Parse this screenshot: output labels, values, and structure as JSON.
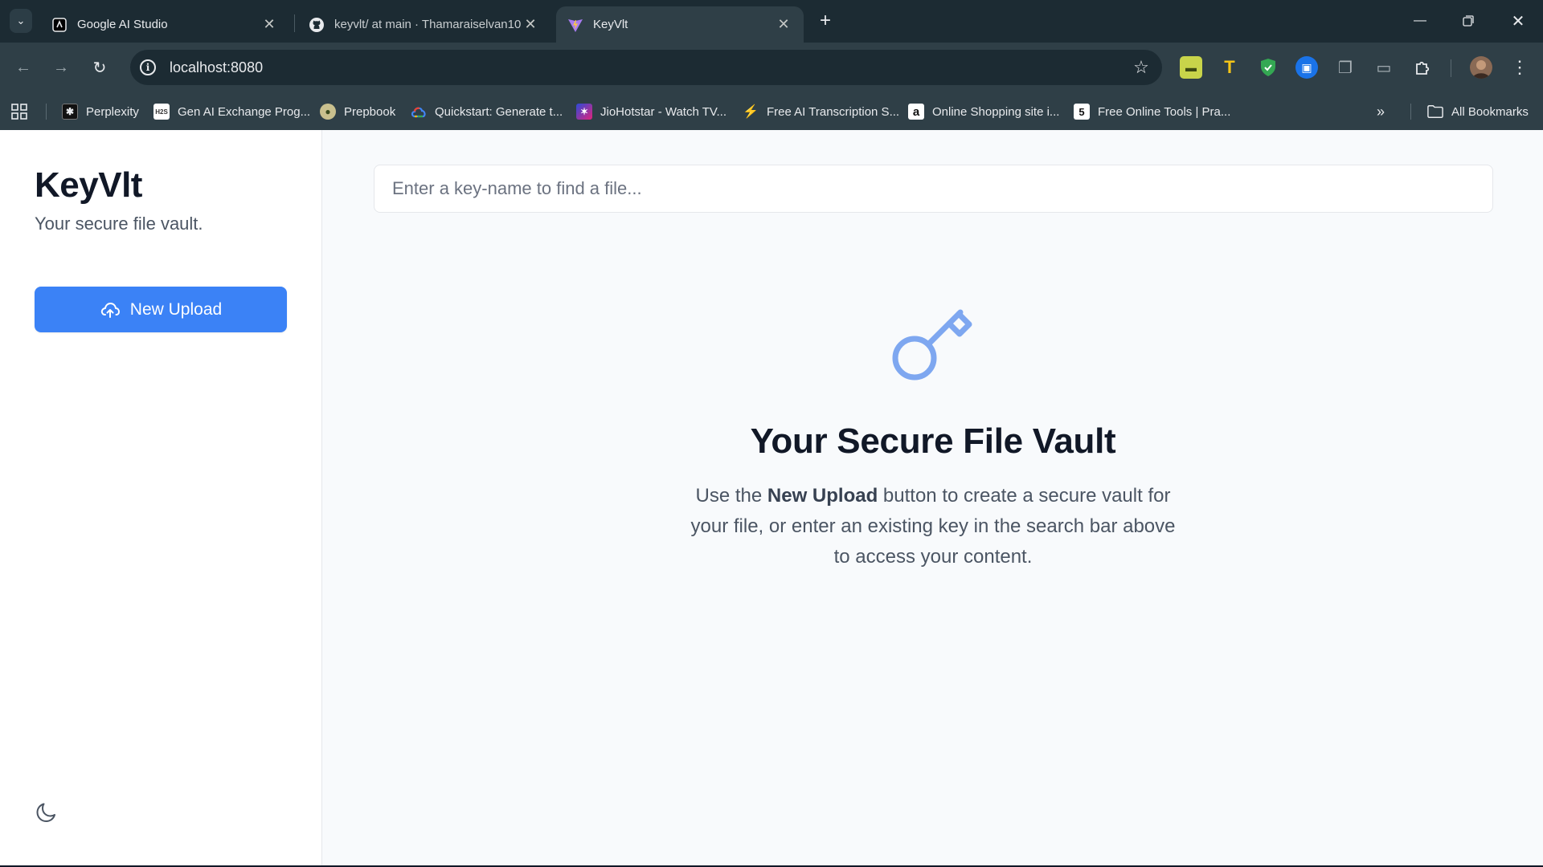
{
  "browser": {
    "tabs": [
      {
        "title": "Google AI Studio",
        "active": false
      },
      {
        "title": "keyvlt/ at main · Thamaraiselvan10",
        "active": false
      },
      {
        "title": "KeyVlt",
        "active": true
      }
    ],
    "url": "localhost:8080",
    "bookmarks": [
      {
        "label": "Perplexity",
        "icon": "perplexity-icon"
      },
      {
        "label": "Gen AI Exchange Prog...",
        "icon": "genai-icon"
      },
      {
        "label": "Prepbook",
        "icon": "prepbook-icon"
      },
      {
        "label": "Quickstart: Generate t...",
        "icon": "google-cloud-icon"
      },
      {
        "label": "JioHotstar - Watch TV...",
        "icon": "jiohotstar-icon"
      },
      {
        "label": "Free AI Transcription S...",
        "icon": "lightning-icon"
      },
      {
        "label": "Online Shopping site i...",
        "icon": "amazon-icon"
      },
      {
        "label": "Free Online Tools | Pra...",
        "icon": "tools-icon"
      }
    ],
    "all_bookmarks_label": "All Bookmarks"
  },
  "sidebar": {
    "brand": "KeyVlt",
    "tagline": "Your secure file vault.",
    "upload_label": "New Upload"
  },
  "main": {
    "search_placeholder": "Enter a key-name to find a file...",
    "hero_title": "Your Secure File Vault",
    "hero_text_before": "Use the ",
    "hero_text_bold": "New Upload",
    "hero_text_after": " button to create a secure vault for your file, or enter an existing key in the search bar above to access your content."
  },
  "colors": {
    "accent": "#3b82f6",
    "key_icon": "#7ea7f0",
    "chrome_dark": "#1c2b33",
    "chrome_mid": "#2f3f47"
  }
}
